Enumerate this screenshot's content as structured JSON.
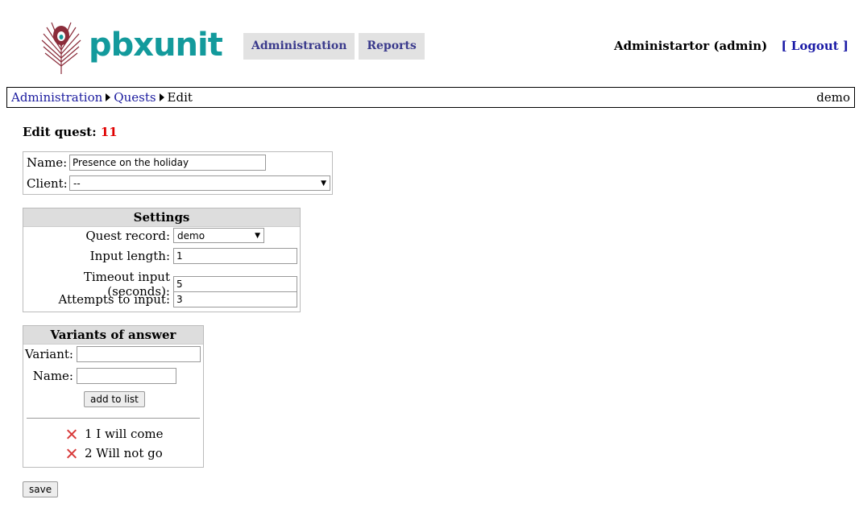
{
  "logo": {
    "text": "pbxunit",
    "icon": "peacock-feather-icon"
  },
  "nav": {
    "tabs": [
      "Administration",
      "Reports"
    ]
  },
  "user": {
    "name": "Administartor (admin)",
    "logout": "[ Logout ]"
  },
  "breadcrumb": {
    "items": [
      "Administration",
      "Quests",
      "Edit"
    ],
    "right": "demo"
  },
  "page": {
    "title": "Edit quest:",
    "id": "11"
  },
  "quest": {
    "name_label": "Name:",
    "name_value": "Presence on the holiday",
    "client_label": "Client:",
    "client_value": "--"
  },
  "settings": {
    "header": "Settings",
    "record_label": "Quest record:",
    "record_value": "demo",
    "length_label": "Input length:",
    "length_value": "1",
    "timeout_label": "Timeout input (seconds):",
    "timeout_value": "5",
    "attempts_label": "Attempts to input:",
    "attempts_value": "3"
  },
  "variants": {
    "header": "Variants of answer",
    "variant_label": "Variant:",
    "variant_value": "",
    "name_label": "Name:",
    "name_value": "",
    "add_button": "add to list",
    "items": [
      "1 I will come",
      "2 Will not go"
    ]
  },
  "save_button": "save",
  "colors": {
    "accent": "#139a9c",
    "id_red": "#e00000",
    "nav_text": "#3a3a8c",
    "delete": "#d83a3a"
  }
}
